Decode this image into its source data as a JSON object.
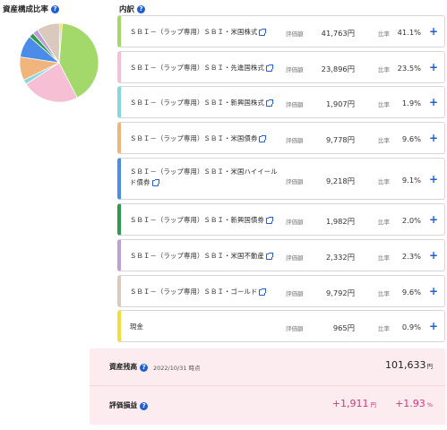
{
  "left": {
    "title": "資産構成比率"
  },
  "right": {
    "title": "内訳"
  },
  "labels": {
    "eval": "評価額",
    "ratio": "比率",
    "plus": "+"
  },
  "holdings": [
    {
      "name": "ＳＢＩ－（ラップ専用）ＳＢＩ・米国株式",
      "amount": "41,763円",
      "ratio": "41.1%",
      "color": "#a3d86a",
      "ext": true
    },
    {
      "name": "ＳＢＩ－（ラップ専用）ＳＢＩ・先進国株式",
      "amount": "23,896円",
      "ratio": "23.5%",
      "color": "#f6bfd4",
      "ext": true
    },
    {
      "name": "ＳＢＩ－（ラップ専用）ＳＢＩ・新興国株式",
      "amount": "1,907円",
      "ratio": "1.9%",
      "color": "#86d8df",
      "ext": true
    },
    {
      "name": "ＳＢＩ－（ラップ専用）ＳＢＩ・米国債券",
      "amount": "9,778円",
      "ratio": "9.6%",
      "color": "#efb57c",
      "ext": true
    },
    {
      "name": "ＳＢＩ－（ラップ専用）ＳＢＩ・米国ハイイールド債券",
      "amount": "9,218円",
      "ratio": "9.1%",
      "color": "#4b8ce8",
      "ext": true
    },
    {
      "name": "ＳＢＩ－（ラップ専用）ＳＢＩ・新興国債券",
      "amount": "1,982円",
      "ratio": "2.0%",
      "color": "#2f9a4f",
      "ext": true
    },
    {
      "name": "ＳＢＩ－（ラップ専用）ＳＢＩ・米国不動産",
      "amount": "2,332円",
      "ratio": "2.3%",
      "color": "#bd9ed6",
      "ext": true
    },
    {
      "name": "ＳＢＩ－（ラップ専用）ＳＢＩ・ゴールド",
      "amount": "9,792円",
      "ratio": "9.6%",
      "color": "#d9cabd",
      "ext": true
    },
    {
      "name": "現金",
      "amount": "965円",
      "ratio": "0.9%",
      "color": "#f3dd3c",
      "ext": false
    }
  ],
  "pie": {
    "values": [
      41.1,
      23.5,
      1.9,
      9.6,
      9.1,
      2.0,
      2.3,
      9.6,
      0.9
    ]
  },
  "summary": {
    "balance_label": "資産残高",
    "balance_date": "2022/10/31 時点",
    "balance_amount": "101,633",
    "balance_unit": "円",
    "pl_label": "評価損益",
    "pl_amount": "+1,911",
    "pl_unit": "円",
    "pl_rate": "+1.93",
    "pl_rate_unit": "%"
  }
}
